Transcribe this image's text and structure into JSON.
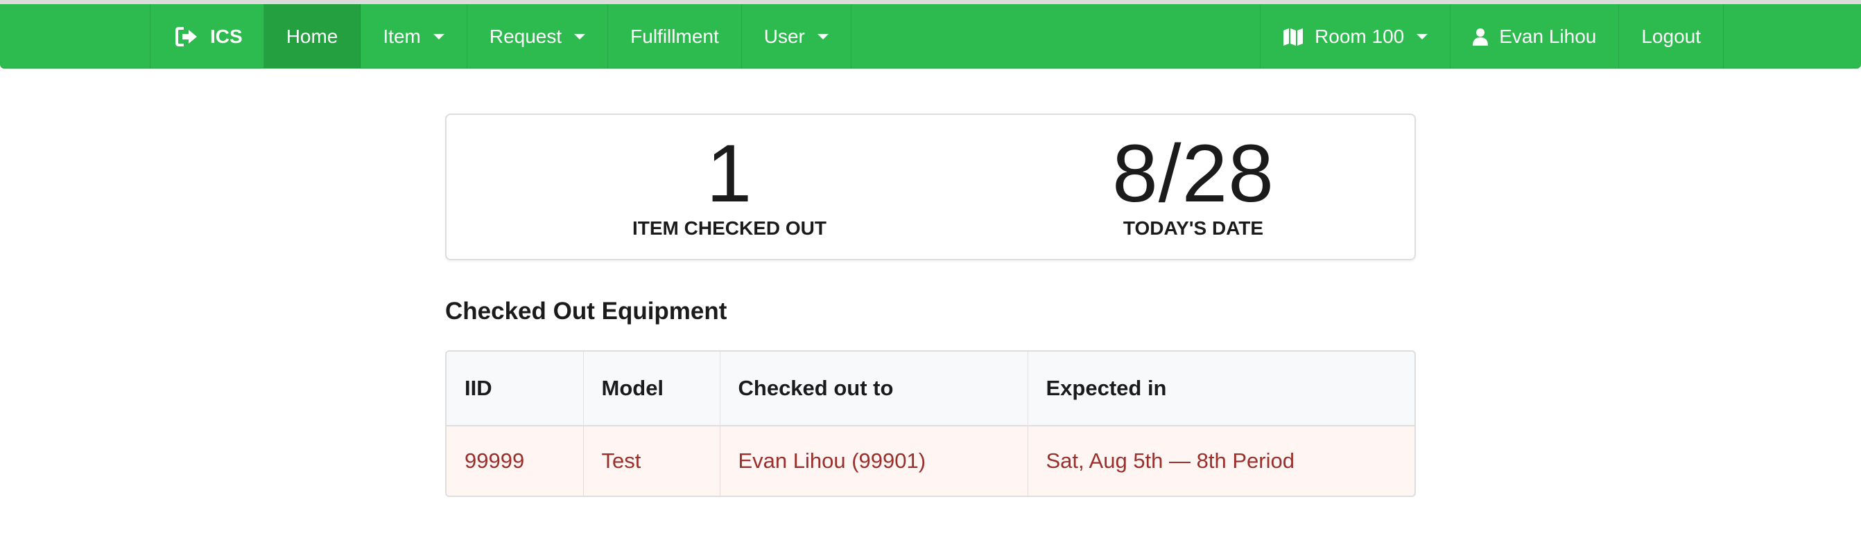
{
  "navbar": {
    "brand": "ICS",
    "items": [
      {
        "label": "Home"
      },
      {
        "label": "Item"
      },
      {
        "label": "Request"
      },
      {
        "label": "Fulfillment"
      },
      {
        "label": "User"
      }
    ],
    "right": {
      "room": "Room 100",
      "user": "Evan Lihou",
      "logout": "Logout"
    }
  },
  "stats": [
    {
      "value": "1",
      "label": "ITEM CHECKED OUT"
    },
    {
      "value": "8/28",
      "label": "TODAY'S DATE"
    }
  ],
  "section": {
    "title": "Checked Out Equipment"
  },
  "table": {
    "headers": [
      "IID",
      "Model",
      "Checked out to",
      "Expected in"
    ],
    "rows": [
      [
        "99999",
        "Test",
        "Evan Lihou (99901)",
        "Sat, Aug 5th — 8th Period"
      ]
    ]
  },
  "colors": {
    "navbar": "#2dba4e",
    "navbar_active": "#24a040",
    "overdue_row_bg": "#fff5f3",
    "overdue_text": "#9a2f2b"
  },
  "icons": {
    "brand": "sign-in-icon",
    "room": "map-icon",
    "user": "user-icon"
  }
}
